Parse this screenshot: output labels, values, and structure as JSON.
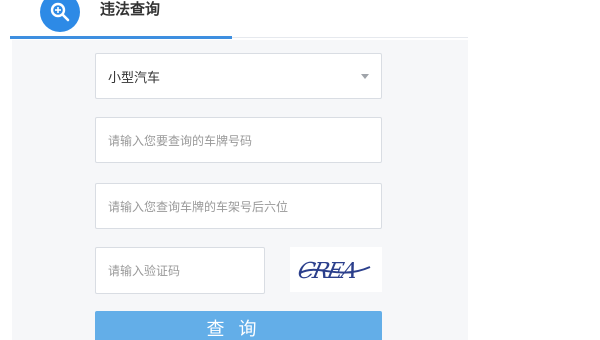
{
  "tab": {
    "title": "违法查询",
    "icon": "search-icon",
    "accent_color": "#2d8ae6"
  },
  "form": {
    "vehicle_type": {
      "selected": "小型汽车",
      "icon": "chevron-down-icon"
    },
    "plate_number": {
      "placeholder": "请输入您要查询的车牌号码"
    },
    "frame_number": {
      "placeholder": "请输入您查询车牌的车架号后六位"
    },
    "captcha": {
      "placeholder": "请输入验证码",
      "image_text": "CREA"
    },
    "submit_label": "查询",
    "button_color": "#63aee8"
  }
}
